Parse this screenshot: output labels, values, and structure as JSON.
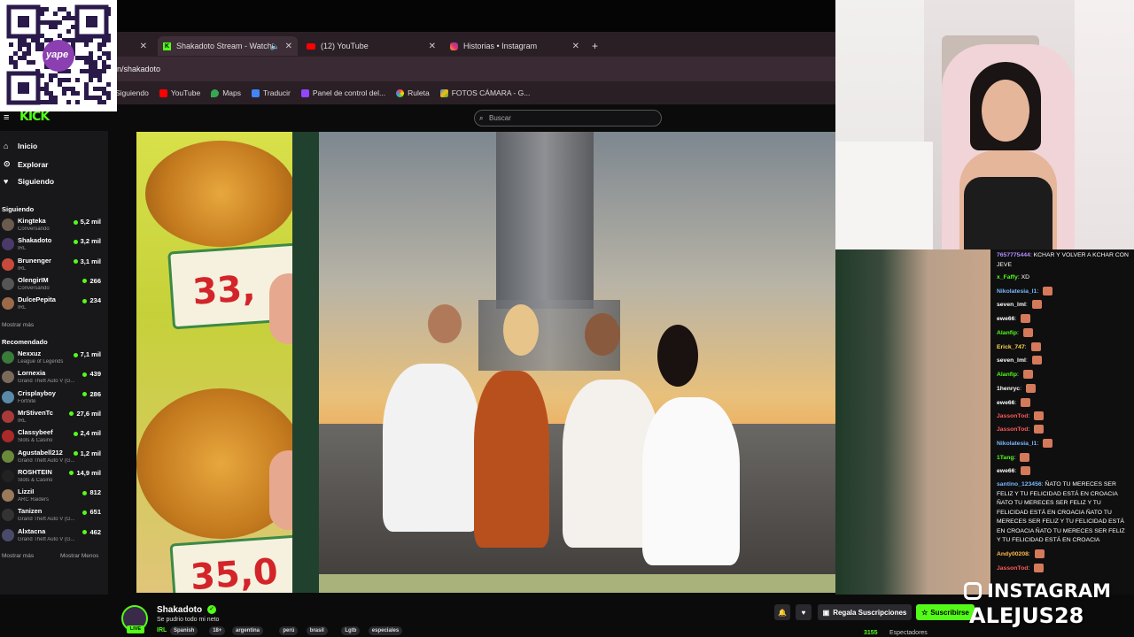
{
  "browser": {
    "tabs": [
      {
        "label": "Shakadoto Stream - Watch"
      },
      {
        "label": "(12) YouTube"
      },
      {
        "label": "Historias • Instagram"
      }
    ],
    "url": "n/shakadoto",
    "bookmarks": [
      "Siguiendo",
      "YouTube",
      "Maps",
      "Traducir",
      "Panel de control del...",
      "Ruleta",
      "FOTOS CÁMARA - G..."
    ]
  },
  "kick": {
    "logo": "KICK",
    "search_placeholder": "Buscar",
    "nav": [
      {
        "label": "Inicio",
        "icon": "home-icon"
      },
      {
        "label": "Explorar",
        "icon": "compass-icon"
      },
      {
        "label": "Siguiendo",
        "icon": "heart-icon"
      }
    ],
    "following_title": "Siguiendo",
    "following": [
      {
        "name": "Kingteka",
        "category": "Conversando",
        "viewers": "5,2 mil",
        "color": "#6b5b4f"
      },
      {
        "name": "Shakadoto",
        "category": "IRL",
        "viewers": "3,2 mil",
        "color": "#4a3a6a"
      },
      {
        "name": "Brunenger",
        "category": "IRL",
        "viewers": "3,1 mil",
        "color": "#c84a3a"
      },
      {
        "name": "OlengirIM",
        "category": "Conversando",
        "viewers": "266",
        "color": "#555"
      },
      {
        "name": "DulcePepita",
        "category": "IRL",
        "viewers": "234",
        "color": "#9a6a4a"
      }
    ],
    "show_more": "Mostrar más",
    "recommended_title": "Recomendado",
    "recommended": [
      {
        "name": "Nexxuz",
        "category": "League of Legends",
        "viewers": "7,1 mil",
        "color": "#3a7a3a"
      },
      {
        "name": "Lornexia",
        "category": "Grand Theft Auto V (G...",
        "viewers": "439",
        "color": "#7a6a5a"
      },
      {
        "name": "Crisplayboy",
        "category": "Fortnite",
        "viewers": "286",
        "color": "#5a8aaa"
      },
      {
        "name": "MrStivenTc",
        "category": "IRL",
        "viewers": "27,6 mil",
        "color": "#a83a3a"
      },
      {
        "name": "Classybeef",
        "category": "Slots & Casino",
        "viewers": "2,4 mil",
        "color": "#aa2a2a"
      },
      {
        "name": "Agustabell212",
        "category": "Grand Theft Auto V (G...",
        "viewers": "1,2 mil",
        "color": "#6a8a3a"
      },
      {
        "name": "ROSHTEIN",
        "category": "Slots & Casino",
        "viewers": "14,9 mil",
        "color": "#222"
      },
      {
        "name": "LizziI",
        "category": "ARC Raiders",
        "viewers": "812",
        "color": "#9a7a5a"
      },
      {
        "name": "Tanizen",
        "category": "Grand Theft Auto V (G...",
        "viewers": "651",
        "color": "#333"
      },
      {
        "name": "Alxtacna",
        "category": "Grand Theft Auto V (G...",
        "viewers": "462",
        "color": "#4a4a6a"
      }
    ],
    "show_more_2": "Mostrar más",
    "show_less": "Mostrar Menos"
  },
  "video": {
    "price1": "33,",
    "price2": "35,0"
  },
  "stream": {
    "channel": "Shakadoto",
    "title": "Se pudrio todo mi neto",
    "live_badge": "LIVE",
    "category": "IRL",
    "tags": [
      "Spanish",
      "18+",
      "argentina",
      "perú",
      "brasil",
      "Lgtb",
      "especiales"
    ],
    "gift_button": "Regala Suscripciones",
    "subscribe_button": "Suscribirse",
    "viewers": "3155",
    "viewers_label": "Espectadores"
  },
  "chat": {
    "messages": [
      {
        "user": "7657775444",
        "text": "KCHAR Y VOLVER A KCHAR CON JEVE",
        "color": "#b48cff"
      },
      {
        "user": "x_Faffy",
        "text": "XD",
        "color": "#53fc18"
      },
      {
        "user": "Nikolatesia_l1",
        "text": "",
        "color": "#7ab8ff"
      },
      {
        "user": "seven_lml",
        "text": "",
        "color": "#ffffff"
      },
      {
        "user": "ewe66",
        "text": "",
        "color": "#ffffff"
      },
      {
        "user": "Alanfip",
        "text": "",
        "color": "#53fc18"
      },
      {
        "user": "Erick_747",
        "text": "",
        "color": "#ffd84a"
      },
      {
        "user": "seven_lml",
        "text": "",
        "color": "#ffffff"
      },
      {
        "user": "Alanfip",
        "text": "",
        "color": "#53fc18"
      },
      {
        "user": "1henryc",
        "text": "",
        "color": "#ffffff"
      },
      {
        "user": "ewe66",
        "text": "",
        "color": "#ffffff"
      },
      {
        "user": "JassonTod",
        "text": "",
        "color": "#ff5a5a"
      },
      {
        "user": "JassonTod",
        "text": "",
        "color": "#ff5a5a"
      },
      {
        "user": "Nikolatesia_l1",
        "text": "",
        "color": "#7ab8ff"
      },
      {
        "user": "1Tang",
        "text": "",
        "color": "#53fc18"
      },
      {
        "user": "ewe66",
        "text": "",
        "color": "#ffffff"
      },
      {
        "user": "santino_123456",
        "text": "ÑATO TU MERECES SER FELIZ Y TU FELICIDAD ESTÁ EN CROACIA ÑATO TU MERECES SER FELIZ Y TU FELICIDAD ESTÁ EN CROACIA ÑATO TU MERECES SER FELIZ Y TU FELICIDAD ESTÁ EN CROACIA ÑATO TU MERECES SER FELIZ Y TU FELICIDAD ESTÁ EN CROACIA",
        "color": "#7ab8ff"
      },
      {
        "user": "Andy00208",
        "text": "",
        "color": "#ffb84a"
      },
      {
        "user": "JassonTod",
        "text": "",
        "color": "#ff5a5a"
      }
    ]
  },
  "overlays": {
    "yape_label": "yape",
    "instagram_line1": "INSTAGRAM",
    "instagram_line2": "ALEJUS28"
  }
}
